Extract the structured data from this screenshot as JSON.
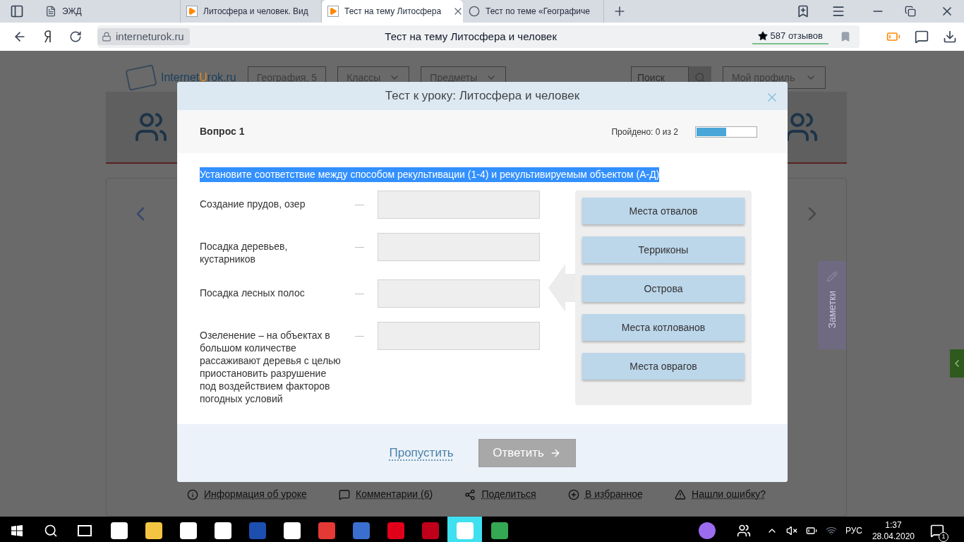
{
  "browser": {
    "tabs": [
      {
        "title": "ЭЖД",
        "selected": false
      },
      {
        "title": "Литосфера и человек. Вид",
        "selected": false
      },
      {
        "title": "Тест на тему Литосфера",
        "selected": true
      },
      {
        "title": "Тест по теме «Географиче",
        "selected": false
      }
    ],
    "address": "interneturok.ru",
    "page_title": "Тест на тему Литосфера и человек",
    "reviews": "587 отзывов"
  },
  "site": {
    "logo_a": "Internet",
    "logo_b": "U",
    "logo_c": "rok.ru",
    "breadcrumb": "География, 5",
    "menus": [
      "Классы",
      "Предметы"
    ],
    "search": {
      "placeholder": "Поиск"
    },
    "profile": "Мой профиль",
    "links": [
      "Информация об уроке",
      "Комментарии (6)",
      "Поделиться",
      "В избранное",
      "Нашли ошибку?"
    ],
    "notes": "Заметки"
  },
  "modal": {
    "title": "Тест к уроку: Литосфера и человек",
    "question": "Вопрос 1",
    "progress_label": "Пройдено: 0 из 2",
    "level": 0.5,
    "prompt": "Установите соответствие между способом рекультивации (1-4) и рекультивируемым объектом (А-Д)",
    "prompt_highlighted": true,
    "items": [
      {
        "text": "Создание прудов, озер",
        "dash": "—"
      },
      {
        "text": "Посадка деревьев, кустарников",
        "dash": "—"
      },
      {
        "text": "Посадка лесных полос",
        "dash": "—"
      },
      {
        "text": "Озеленение – на объектах в большом количестве рассаживают деревья с целью приостановить разрушение под воздействием факторов погодных условий",
        "dash": "—"
      }
    ],
    "options": [
      "Места отвалов",
      "Терриконы",
      "Острова",
      "Места котлованов",
      "Места оврагов"
    ],
    "skip": "Пропустить",
    "submit": {
      "label": "Ответить",
      "disabled": true
    }
  },
  "taskbar": {
    "lang": "РУС",
    "time": "1:37",
    "date": "28.04.2020",
    "notifications": "1"
  }
}
